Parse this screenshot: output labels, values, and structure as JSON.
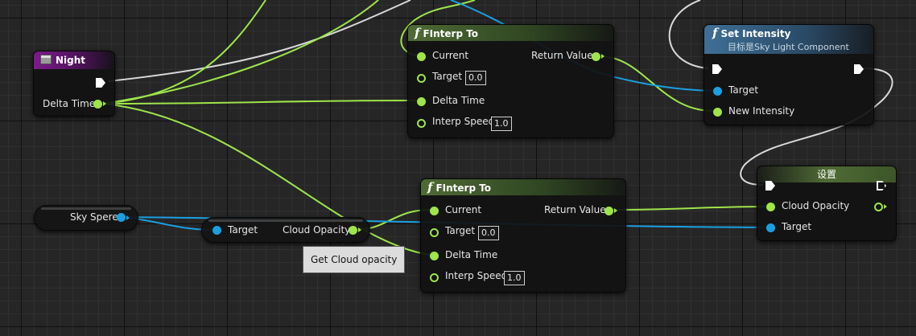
{
  "night_node": {
    "title": "Night",
    "output_label": "Delta Time"
  },
  "finterp_top": {
    "title": "FInterp To",
    "current_label": "Current",
    "target_label": "Target",
    "target_value": "0.0",
    "delta_label": "Delta Time",
    "speed_label": "Interp Speed",
    "speed_value": "1.0",
    "return_label": "Return Value"
  },
  "set_intensity": {
    "title": "Set Intensity",
    "subtitle": "目标是Sky Light Component",
    "target_label": "Target",
    "new_intensity_label": "New Intensity"
  },
  "sky_spere": {
    "label": "Sky Spere"
  },
  "get_cloud": {
    "target_label": "Target",
    "output_label": "Cloud Opacity",
    "tooltip": "Get Cloud opacity"
  },
  "finterp_bottom": {
    "title": "FInterp To",
    "current_label": "Current",
    "target_label": "Target",
    "target_value": "0.0",
    "delta_label": "Delta Time",
    "speed_label": "Interp Speed",
    "speed_value": "1.0",
    "return_label": "Return Value"
  },
  "set_node": {
    "title": "设置",
    "cloud_label": "Cloud Opacity",
    "target_label": "Target"
  },
  "colors": {
    "float_pin": "#9ee54a",
    "object_pin": "#1a9fe0",
    "exec_wire": "#d8d8d8",
    "event_header": "#7d1a8c",
    "function_header": "#4f6b35",
    "target_function_header": "#3f6f96"
  }
}
